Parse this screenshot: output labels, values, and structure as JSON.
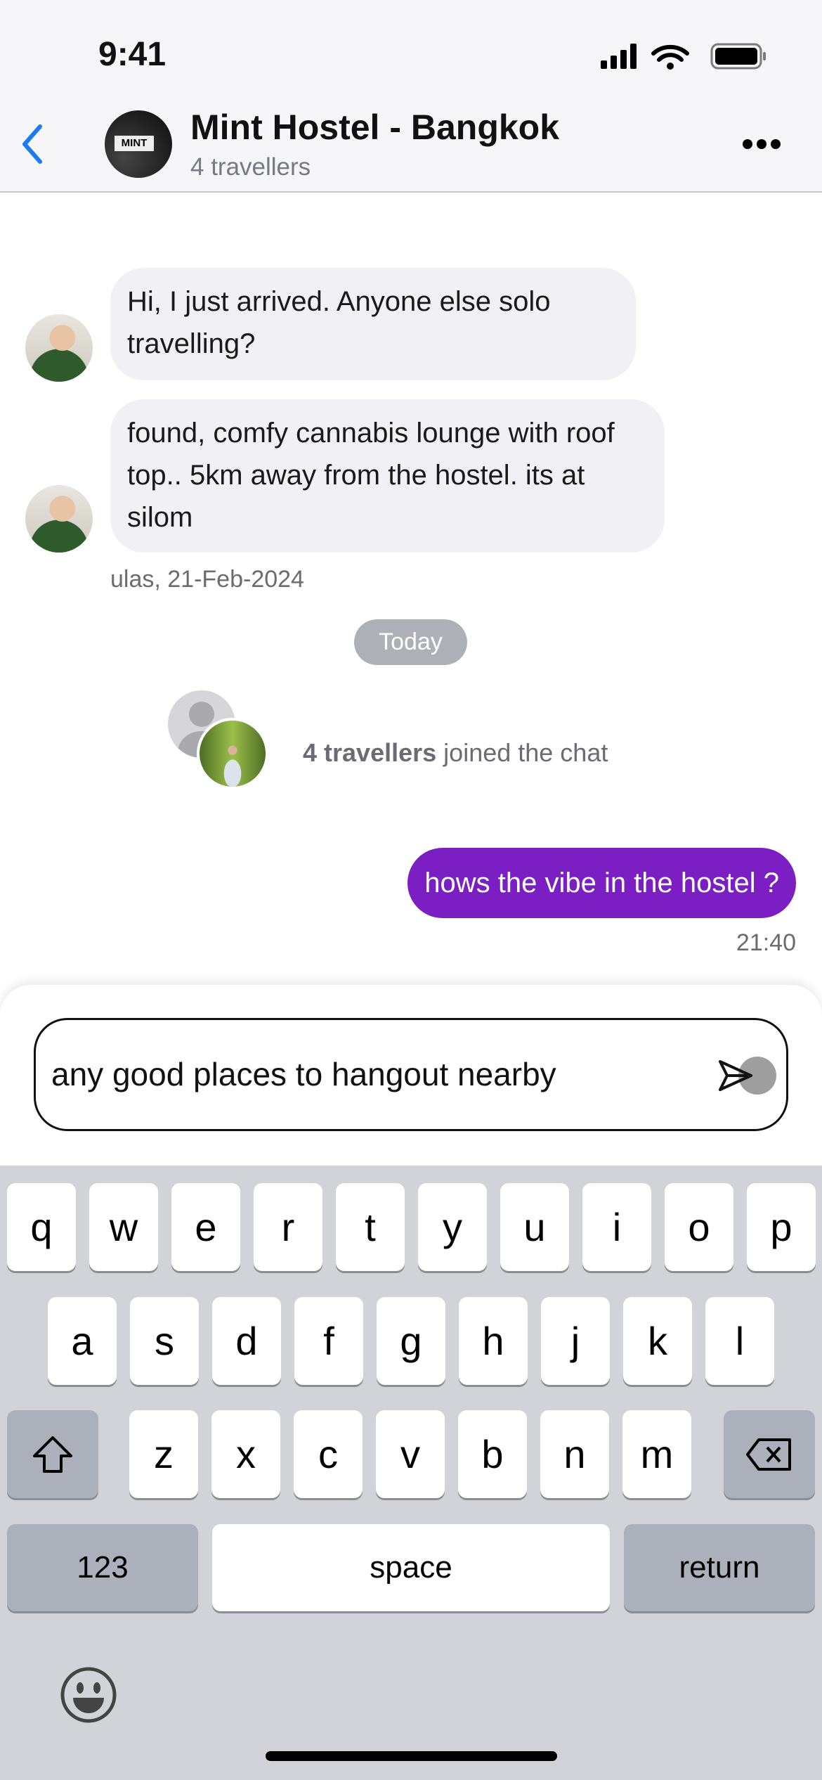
{
  "status_bar": {
    "time": "9:41"
  },
  "header": {
    "title": "Mint Hostel - Bangkok",
    "subtitle": "4 travellers",
    "avatar_logo": "MINT"
  },
  "messages": [
    {
      "text": "Hi, I just arrived. Anyone else solo travelling?"
    },
    {
      "text": "found, comfy cannabis lounge with roof top.. 5km away from the hostel. its at silom"
    }
  ],
  "incoming_meta": "ulas, 21-Feb-2024",
  "date_divider": "Today",
  "joined": {
    "count": "4 travellers",
    "text": "joined the chat"
  },
  "outgoing": {
    "text": "hows the vibe in the hostel ?",
    "time": "21:40"
  },
  "composer": {
    "value": "any good places to hangout nearby"
  },
  "colors": {
    "accent": "#7b1fc4",
    "back": "#1a7cf2",
    "keyboard": "#d1d3d9"
  },
  "keyboard": {
    "row1": [
      "q",
      "w",
      "e",
      "r",
      "t",
      "y",
      "u",
      "i",
      "o",
      "p"
    ],
    "row2": [
      "a",
      "s",
      "d",
      "f",
      "g",
      "h",
      "j",
      "k",
      "l"
    ],
    "row3": [
      "z",
      "x",
      "c",
      "v",
      "b",
      "n",
      "m"
    ],
    "numbers": "123",
    "space": "space",
    "return": "return"
  }
}
